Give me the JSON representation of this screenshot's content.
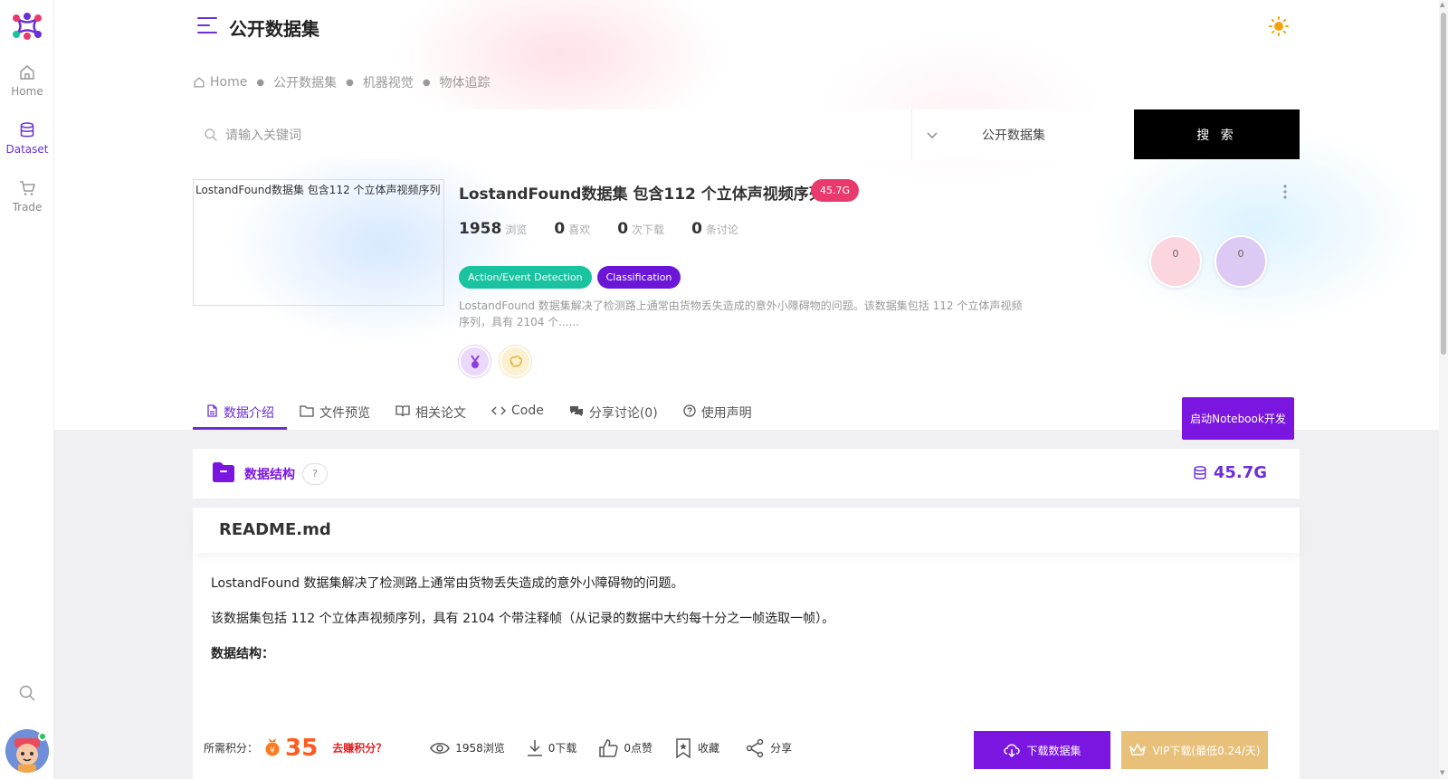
{
  "header": {
    "title": "公开数据集"
  },
  "sidebar": {
    "items": [
      {
        "label": "Home",
        "icon": "home-icon"
      },
      {
        "label": "Dataset",
        "icon": "database-icon"
      },
      {
        "label": "Trade",
        "icon": "cart-icon"
      }
    ]
  },
  "breadcrumb": [
    "Home",
    "公开数据集",
    "机器视觉",
    "物体追踪"
  ],
  "search": {
    "placeholder": "请输入关键词",
    "scope": "公开数据集",
    "button": "搜 索"
  },
  "dataset": {
    "thumb_alt": "LostandFound数据集 包含112 个立体声视频序列",
    "title": "LostandFound数据集 包含112 个立体声视频序列",
    "size": "45.7G",
    "stats": [
      {
        "num": "1958",
        "label": "浏览"
      },
      {
        "num": "0",
        "label": "喜欢"
      },
      {
        "num": "0",
        "label": "次下载"
      },
      {
        "num": "0",
        "label": "条讨论"
      }
    ],
    "tags": [
      {
        "label": "Action/Event Detection",
        "color": "#19c3a0"
      },
      {
        "label": "Classification",
        "color": "#6b16d6"
      }
    ],
    "description": "LostandFound 数据集解决了检测路上通常由货物丢失造成的意外小障碍物的问题。该数据集包括 112 个立体声视频序列，具有 2104 个......",
    "bubbles": [
      "0",
      "0"
    ]
  },
  "tabs": [
    {
      "label": "数据介绍",
      "icon": "file-icon"
    },
    {
      "label": "文件预览",
      "icon": "folder-icon"
    },
    {
      "label": "相关论文",
      "icon": "book-icon"
    },
    {
      "label": "Code",
      "icon": "code-icon"
    },
    {
      "label": "分享讨论(0)",
      "icon": "chat-icon"
    },
    {
      "label": "使用声明",
      "icon": "help-circle-icon"
    }
  ],
  "notebook_button": "启动Notebook开发",
  "structure": {
    "label": "数据结构",
    "help": "?",
    "size": "45.7G"
  },
  "readme": {
    "title": "README.md",
    "paragraphs": [
      "LostandFound 数据集解决了检测路上通常由货物丢失造成的意外小障碍物的问题。",
      "该数据集包括 112 个立体声视频序列，具有 2104 个带注释帧（从记录的数据中大约每十分之一帧选取一帧）。",
      "数据结构："
    ]
  },
  "actions": {
    "points_label": "所需积分：",
    "points_value": "35",
    "earn_link": "去赚积分？",
    "views": "1958浏览",
    "downloads": "0下载",
    "likes": "0点赞",
    "favorite": "收藏",
    "share": "分享",
    "download_button": "下载数据集",
    "vip_button": "VIP下载(最低0.24/天)"
  }
}
